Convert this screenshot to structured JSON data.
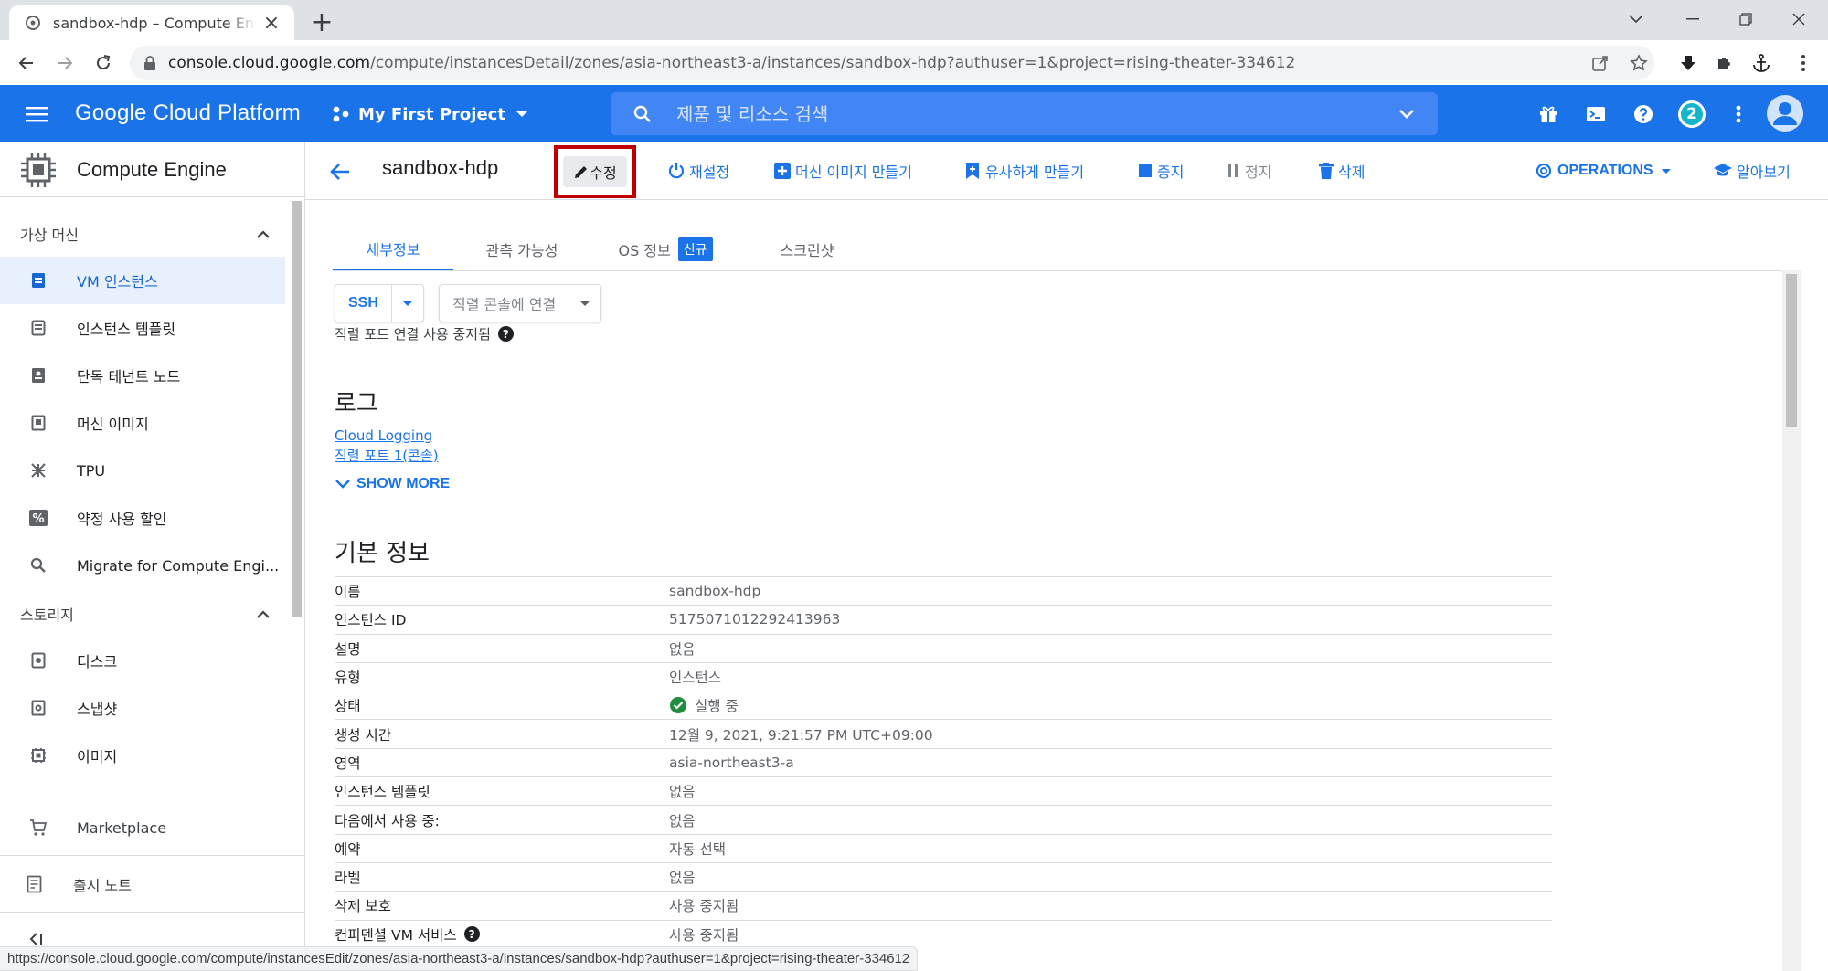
{
  "browser": {
    "tab_title": "sandbox-hdp – Compute Engine",
    "url_host": "console.cloud.google.com",
    "url_path": "/compute/instancesDetail/zones/asia-northeast3-a/instances/sandbox-hdp?authuser=1&project=rising-theater-334612",
    "extension_badge": "2"
  },
  "header": {
    "brand": "Google Cloud Platform",
    "project": "My First Project",
    "search_placeholder": "제품 및 리소스 검색",
    "notification_count": "2"
  },
  "sidebar": {
    "product_title": "Compute Engine",
    "section_vm": "가상 머신",
    "items_vm": [
      {
        "label": "VM 인스턴스",
        "icon": "vm-icon"
      },
      {
        "label": "인스턴스 템플릿",
        "icon": "template-icon"
      },
      {
        "label": "단독 테넌트 노드",
        "icon": "sole-tenant-icon"
      },
      {
        "label": "머신 이미지",
        "icon": "machine-image-icon"
      },
      {
        "label": "TPU",
        "icon": "tpu-icon"
      },
      {
        "label": "약정 사용 할인",
        "icon": "percent-icon"
      },
      {
        "label": "Migrate for Compute Engi...",
        "icon": "search-icon"
      }
    ],
    "section_storage": "스토리지",
    "items_storage": [
      {
        "label": "디스크",
        "icon": "disk-icon"
      },
      {
        "label": "스냅샷",
        "icon": "snapshot-icon"
      },
      {
        "label": "이미지",
        "icon": "image-icon"
      }
    ],
    "marketplace": "Marketplace",
    "release_notes": "출시 노트"
  },
  "actions": {
    "title": "sandbox-hdp",
    "edit": "수정",
    "reset": "재설정",
    "create_machine_image": "머신 이미지 만들기",
    "create_similar": "유사하게 만들기",
    "stop": "중지",
    "suspend": "정지",
    "delete": "삭제",
    "operations": "OPERATIONS",
    "learn": "알아보기"
  },
  "tabs": {
    "details": "세부정보",
    "observability": "관측 가능성",
    "os_info": "OS 정보",
    "new_badge": "신규",
    "screenshot": "스크린샷"
  },
  "connect": {
    "ssh": "SSH",
    "serial": "직렬 콘솔에 연결",
    "hint": "직렬 포트 연결 사용 중지됨"
  },
  "logs": {
    "heading": "로그",
    "cloud_logging": "Cloud Logging",
    "serial_port": "직렬 포트 1(콘솔)",
    "show_more": "SHOW MORE"
  },
  "basic": {
    "heading": "기본 정보",
    "rows": [
      {
        "k": "이름",
        "v": "sandbox-hdp"
      },
      {
        "k": "인스턴스 ID",
        "v": "5175071012292413963"
      },
      {
        "k": "설명",
        "v": "없음"
      },
      {
        "k": "유형",
        "v": "인스턴스"
      },
      {
        "k": "상태",
        "v": "실행 중"
      },
      {
        "k": "생성 시간",
        "v": "12월 9, 2021, 9:21:57 PM UTC+09:00"
      },
      {
        "k": "영역",
        "v": "asia-northeast3-a"
      },
      {
        "k": "인스턴스 템플릿",
        "v": "없음"
      },
      {
        "k": "다음에서 사용 중:",
        "v": "없음"
      },
      {
        "k": "예약",
        "v": "자동 선택"
      },
      {
        "k": "라벨",
        "v": "없음"
      },
      {
        "k": "삭제 보호",
        "v": "사용 중지됨"
      },
      {
        "k": "컨피덴셜 VM 서비스",
        "v": "사용 중지됨"
      }
    ]
  },
  "status_url": "https://console.cloud.google.com/compute/instancesEdit/zones/asia-northeast3-a/instances/sandbox-hdp?authuser=1&project=rising-theater-334612",
  "colors": {
    "primary": "#1a73e8",
    "highlight_box": "#c00000",
    "success": "#1e8e3e"
  }
}
